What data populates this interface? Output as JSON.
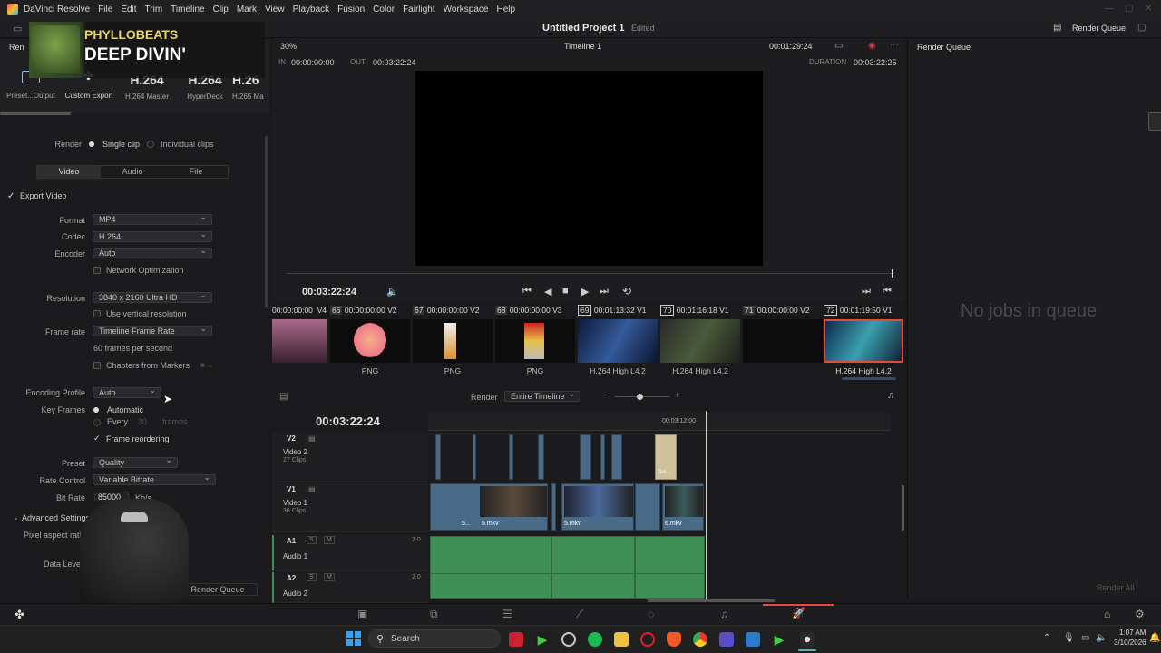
{
  "app": {
    "menu": [
      "DaVinci Resolve",
      "File",
      "Edit",
      "Trim",
      "Timeline",
      "Clip",
      "Mark",
      "View",
      "Playback",
      "Fusion",
      "Color",
      "Fairlight",
      "Workspace",
      "Help"
    ],
    "project_title": "Untitled Project 1",
    "project_status": "Edited",
    "render_queue_label": "Render Queue"
  },
  "overlay": {
    "channel": "PHYLLOBEATS",
    "title": "DEEP DIVIN'"
  },
  "presets": [
    {
      "big": "",
      "label": "Preset...Output"
    },
    {
      "big": "",
      "label": "Custom Export"
    },
    {
      "big": "H.264",
      "label": "H.264 Master"
    },
    {
      "big": "H.264",
      "label": "HyperDeck"
    },
    {
      "big": "H.26",
      "label": "H.265 Ma"
    }
  ],
  "render_settings": {
    "truncated_tab": "Ren",
    "render_label": "Render",
    "single_clip": "Single clip",
    "individual_clips": "Individual clips",
    "tabs": [
      "Video",
      "Audio",
      "File"
    ],
    "export_video": "Export Video",
    "format_label": "Format",
    "format": "MP4",
    "codec_label": "Codec",
    "codec": "H.264",
    "encoder_label": "Encoder",
    "encoder": "Auto",
    "network_opt": "Network Optimization",
    "resolution_label": "Resolution",
    "resolution": "3840 x 2160 Ultra HD",
    "vertical_res": "Use vertical resolution",
    "frame_rate_label": "Frame rate",
    "frame_rate": "Timeline Frame Rate",
    "fps_note": "60 frames per second",
    "chapters": "Chapters from Markers",
    "encoding_profile_label": "Encoding Profile",
    "encoding_profile": "Auto",
    "key_frames_label": "Key Frames",
    "kf_auto": "Automatic",
    "kf_every": "Every",
    "kf_every_value": "30",
    "kf_frames": "frames",
    "frame_reordering": "Frame reordering",
    "preset_label": "Preset",
    "preset": "Quality",
    "rate_control_label": "Rate Control",
    "rate_control": "Variable Bitrate",
    "bit_rate_label": "Bit Rate",
    "bit_rate": "85000",
    "bit_rate_unit": "Kb/s",
    "advanced": "Advanced Settings",
    "pixel_aspect": "Pixel aspect rati",
    "data_levels": "Data Level",
    "add_queue": "Render Queue"
  },
  "viewer": {
    "zoom": "30%",
    "timeline_name": "Timeline 1",
    "timecode_top": "00:01:29:24",
    "in_label": "IN",
    "in_tc": "00:00:00:00",
    "out_label": "OUT",
    "out_tc": "00:03:22:24",
    "duration_label": "DURATION",
    "duration_tc": "00:03:22:25",
    "current_tc": "00:03:22:24"
  },
  "clips": [
    {
      "num": "",
      "tc": "",
      "track": "V4",
      "codec": ""
    },
    {
      "num": "66",
      "tc": "00:00:00:00",
      "track": "V2",
      "codec": "PNG"
    },
    {
      "num": "67",
      "tc": "00:00:00:00",
      "track": "V2",
      "codec": "PNG"
    },
    {
      "num": "68",
      "tc": "00:00:00:00",
      "track": "V3",
      "codec": "PNG"
    },
    {
      "num": "69",
      "tc": "00:01:13:32",
      "track": "V1",
      "codec": "H.264 High L4.2"
    },
    {
      "num": "70",
      "tc": "00:01:16:18",
      "track": "V1",
      "codec": "H.264 High L4.2"
    },
    {
      "num": "71",
      "tc": "00:00:00:00",
      "track": "V2",
      "codec": ""
    },
    {
      "num": "72",
      "tc": "00:01:19:50",
      "track": "V1",
      "codec": "H.264 High L4.2"
    }
  ],
  "clips_first_tc": "00:00:00:00",
  "timeline": {
    "render_label": "Render",
    "render_range": "Entire Timeline",
    "big_tc": "00:03:22:24",
    "ruler_tc": "00:03:12:00",
    "tracks": [
      {
        "id": "V2",
        "name": "Video 2",
        "count": "27 Clips"
      },
      {
        "id": "V1",
        "name": "Video 1",
        "count": "36 Clips"
      },
      {
        "id": "A1",
        "name": "Audio 1",
        "level": "2.0"
      },
      {
        "id": "A2",
        "name": "Audio 2",
        "level": "2.0"
      }
    ],
    "clip_names": [
      "5...",
      "5.mkv",
      "5.mkv",
      "6.mkv"
    ],
    "text_clip": "Tex..."
  },
  "render_queue": {
    "empty": "No jobs in queue",
    "render_all": "Render All"
  },
  "taskbar": {
    "search": "Search",
    "time": "1:07 AM",
    "date": "3/10/2026"
  },
  "colors": {
    "accent": "#e84a3a",
    "video_clip": "#4a6b88",
    "audio_clip": "#3f8f57"
  }
}
